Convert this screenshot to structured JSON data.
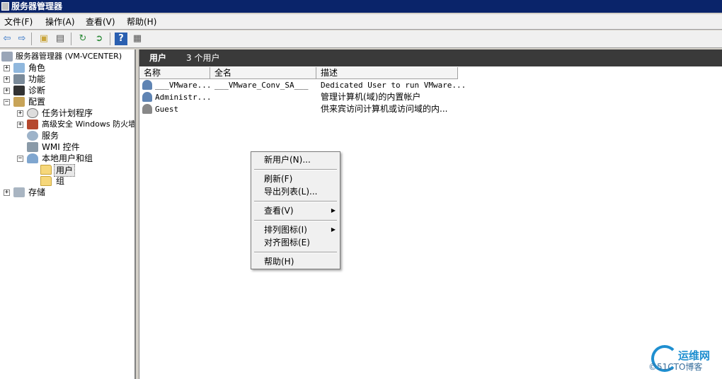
{
  "window": {
    "title": "服务器管理器"
  },
  "menu": [
    "文件(F)",
    "操作(A)",
    "查看(V)",
    "帮助(H)"
  ],
  "toolbar": {
    "buttons": [
      "back-icon",
      "forward-icon",
      "up-folder-icon",
      "show-hide-tree-icon",
      "refresh-icon",
      "export-list-icon",
      "help-icon",
      "properties-icon"
    ]
  },
  "tree": {
    "root": "服务器管理器 (VM-VCENTER)",
    "roles": "角色",
    "features": "功能",
    "diagnostics": "诊断",
    "configuration": "配置",
    "task_scheduler": "任务计划程序",
    "firewall": "高级安全 Windows 防火墙",
    "services": "服务",
    "wmi": "WMI 控件",
    "local_users_groups": "本地用户和组",
    "users": "用户",
    "groups": "组",
    "storage": "存储"
  },
  "panel": {
    "title": "用户",
    "count": "3 个用户",
    "columns": [
      "名称",
      "全名",
      "描述"
    ],
    "rows": [
      {
        "name": "___VMware...",
        "fullname": "___VMware_Conv_SA___",
        "description": "Dedicated User to run VMware..."
      },
      {
        "name": "Administr...",
        "fullname": "",
        "description": "管理计算机(域)的内置帐户"
      },
      {
        "name": "Guest",
        "fullname": "",
        "description": "供来宾访问计算机或访问域的内..."
      }
    ]
  },
  "context_menu": {
    "new_user": "新用户(N)...",
    "refresh": "刷新(F)",
    "export": "导出列表(L)...",
    "view": "查看(V)",
    "arrange": "排列图标(I)",
    "align": "对齐图标(E)",
    "help": "帮助(H)"
  },
  "watermark": {
    "name": "运维网",
    "site": "©51CTO博客"
  },
  "colors": {
    "title_bar": "#0a246a",
    "panel_header": "#3a3a3a",
    "watermark": "#1f8fd0"
  }
}
